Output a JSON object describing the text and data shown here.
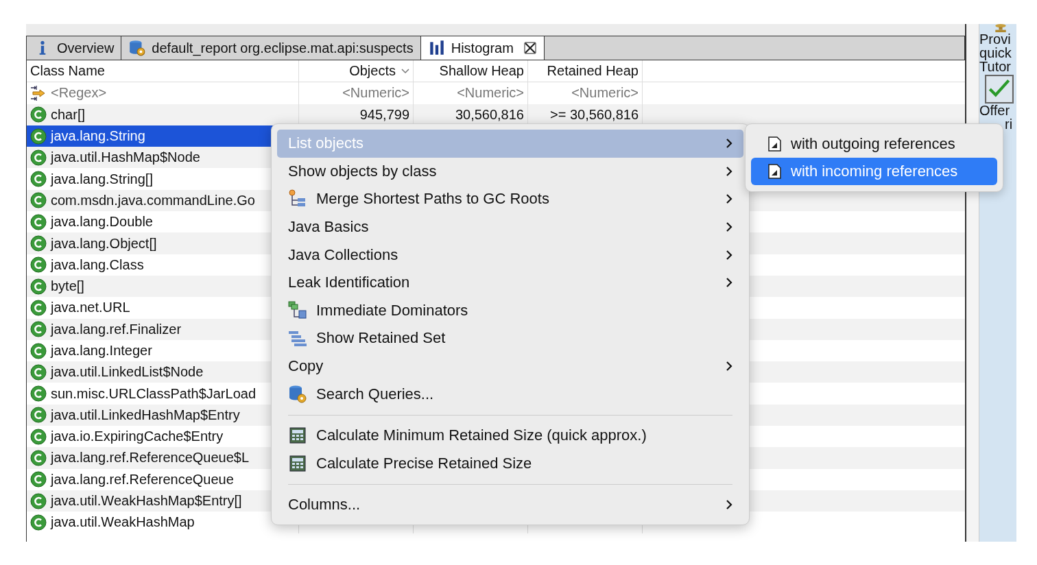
{
  "tabs": [
    {
      "label": "Overview",
      "selected": false,
      "closable": false
    },
    {
      "label": "default_report  org.eclipse.mat.api:suspects",
      "selected": false,
      "closable": false
    },
    {
      "label": "Histogram",
      "selected": true,
      "closable": true
    }
  ],
  "table": {
    "columns": [
      {
        "label": "Class Name",
        "sorted": false
      },
      {
        "label": "Objects",
        "sorted": true
      },
      {
        "label": "Shallow Heap",
        "sorted": false
      },
      {
        "label": "Retained Heap",
        "sorted": false
      }
    ],
    "filter_row": [
      "<Regex>",
      "<Numeric>",
      "<Numeric>",
      "<Numeric>"
    ],
    "rows": [
      {
        "name": "char[]",
        "selected": false,
        "values": [
          "945,799",
          "30,560,816",
          ">= 30,560,816"
        ]
      },
      {
        "name": "java.lang.String",
        "selected": true
      },
      {
        "name": "java.util.HashMap$Node",
        "selected": false
      },
      {
        "name": "java.lang.String[]",
        "selected": false
      },
      {
        "name": "com.msdn.java.commandLine.Go",
        "selected": false
      },
      {
        "name": "java.lang.Double",
        "selected": false
      },
      {
        "name": "java.lang.Object[]",
        "selected": false
      },
      {
        "name": "java.lang.Class",
        "selected": false
      },
      {
        "name": "byte[]",
        "selected": false
      },
      {
        "name": "java.net.URL",
        "selected": false
      },
      {
        "name": "java.lang.ref.Finalizer",
        "selected": false
      },
      {
        "name": "java.lang.Integer",
        "selected": false
      },
      {
        "name": "java.util.LinkedList$Node",
        "selected": false
      },
      {
        "name": "sun.misc.URLClassPath$JarLoad",
        "selected": false
      },
      {
        "name": "java.util.LinkedHashMap$Entry",
        "selected": false
      },
      {
        "name": "java.io.ExpiringCache$Entry",
        "selected": false
      },
      {
        "name": "java.lang.ref.ReferenceQueue$L",
        "selected": false
      },
      {
        "name": "java.lang.ref.ReferenceQueue",
        "selected": false
      },
      {
        "name": "java.util.WeakHashMap$Entry[]",
        "selected": false
      },
      {
        "name": "java.util.WeakHashMap",
        "selected": false
      }
    ]
  },
  "side_panel": {
    "texts": [
      "Provi",
      "quick",
      "Tutor"
    ],
    "texts_after_icon": [
      "Offer",
      "ri"
    ]
  },
  "context_menu": [
    {
      "kind": "item",
      "label": "List objects",
      "submenu": true,
      "selected": true
    },
    {
      "kind": "item",
      "label": "Show objects by class",
      "submenu": true,
      "selected": false
    },
    {
      "kind": "item",
      "label": "Merge Shortest Paths to GC Roots",
      "submenu": true,
      "selected": false
    },
    {
      "kind": "item",
      "label": "Java Basics",
      "submenu": true,
      "selected": false
    },
    {
      "kind": "item",
      "label": "Java Collections",
      "submenu": true,
      "selected": false
    },
    {
      "kind": "item",
      "label": "Leak Identification",
      "submenu": true,
      "selected": false
    },
    {
      "kind": "item",
      "label": "Immediate Dominators",
      "submenu": false,
      "selected": false
    },
    {
      "kind": "item",
      "label": "Show Retained Set",
      "submenu": false,
      "selected": false
    },
    {
      "kind": "item",
      "label": "Copy",
      "submenu": true,
      "selected": false
    },
    {
      "kind": "item",
      "label": "Search Queries...",
      "submenu": false,
      "selected": false
    },
    {
      "kind": "separator"
    },
    {
      "kind": "item",
      "label": "Calculate Minimum Retained Size (quick approx.)",
      "submenu": false,
      "selected": false
    },
    {
      "kind": "item",
      "label": "Calculate Precise Retained Size",
      "submenu": false,
      "selected": false
    },
    {
      "kind": "separator"
    },
    {
      "kind": "item",
      "label": "Columns...",
      "submenu": true,
      "selected": false
    }
  ],
  "submenu": [
    {
      "label": "with outgoing references",
      "selected": false
    },
    {
      "label": "with incoming references",
      "selected": true
    }
  ]
}
